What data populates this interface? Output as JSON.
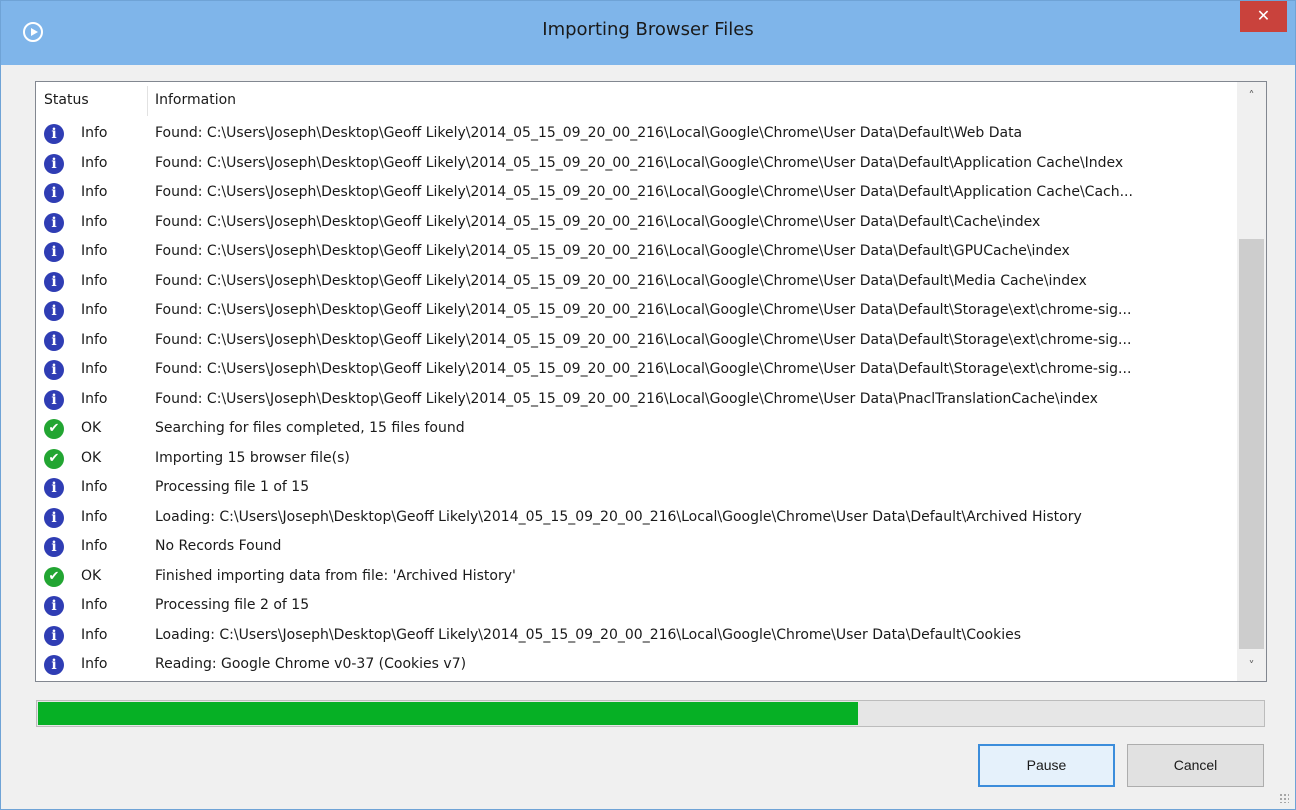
{
  "window": {
    "title": "Importing Browser Files",
    "close_glyph": "✕"
  },
  "columns": {
    "status": "Status",
    "information": "Information"
  },
  "rows": [
    {
      "icon": "info-icon",
      "status": "Info",
      "message": "Found: C:\\Users\\Joseph\\Desktop\\Geoff Likely\\2014_05_15_09_20_00_216\\Local\\Google\\Chrome\\User Data\\Default\\Web Data"
    },
    {
      "icon": "info-icon",
      "status": "Info",
      "message": "Found: C:\\Users\\Joseph\\Desktop\\Geoff Likely\\2014_05_15_09_20_00_216\\Local\\Google\\Chrome\\User Data\\Default\\Application Cache\\Index"
    },
    {
      "icon": "info-icon",
      "status": "Info",
      "message": "Found: C:\\Users\\Joseph\\Desktop\\Geoff Likely\\2014_05_15_09_20_00_216\\Local\\Google\\Chrome\\User Data\\Default\\Application Cache\\Cach..."
    },
    {
      "icon": "info-icon",
      "status": "Info",
      "message": "Found: C:\\Users\\Joseph\\Desktop\\Geoff Likely\\2014_05_15_09_20_00_216\\Local\\Google\\Chrome\\User Data\\Default\\Cache\\index"
    },
    {
      "icon": "info-icon",
      "status": "Info",
      "message": "Found: C:\\Users\\Joseph\\Desktop\\Geoff Likely\\2014_05_15_09_20_00_216\\Local\\Google\\Chrome\\User Data\\Default\\GPUCache\\index"
    },
    {
      "icon": "info-icon",
      "status": "Info",
      "message": "Found: C:\\Users\\Joseph\\Desktop\\Geoff Likely\\2014_05_15_09_20_00_216\\Local\\Google\\Chrome\\User Data\\Default\\Media Cache\\index"
    },
    {
      "icon": "info-icon",
      "status": "Info",
      "message": "Found: C:\\Users\\Joseph\\Desktop\\Geoff Likely\\2014_05_15_09_20_00_216\\Local\\Google\\Chrome\\User Data\\Default\\Storage\\ext\\chrome-sig..."
    },
    {
      "icon": "info-icon",
      "status": "Info",
      "message": "Found: C:\\Users\\Joseph\\Desktop\\Geoff Likely\\2014_05_15_09_20_00_216\\Local\\Google\\Chrome\\User Data\\Default\\Storage\\ext\\chrome-sig..."
    },
    {
      "icon": "info-icon",
      "status": "Info",
      "message": "Found: C:\\Users\\Joseph\\Desktop\\Geoff Likely\\2014_05_15_09_20_00_216\\Local\\Google\\Chrome\\User Data\\Default\\Storage\\ext\\chrome-sig..."
    },
    {
      "icon": "info-icon",
      "status": "Info",
      "message": "Found: C:\\Users\\Joseph\\Desktop\\Geoff Likely\\2014_05_15_09_20_00_216\\Local\\Google\\Chrome\\User Data\\PnaclTranslationCache\\index"
    },
    {
      "icon": "ok-icon",
      "status": "OK",
      "message": "Searching for files completed, 15 files found"
    },
    {
      "icon": "ok-icon",
      "status": "OK",
      "message": "Importing 15 browser file(s)"
    },
    {
      "icon": "info-icon",
      "status": "Info",
      "message": "Processing file 1 of 15"
    },
    {
      "icon": "info-icon",
      "status": "Info",
      "message": "Loading: C:\\Users\\Joseph\\Desktop\\Geoff Likely\\2014_05_15_09_20_00_216\\Local\\Google\\Chrome\\User Data\\Default\\Archived History"
    },
    {
      "icon": "info-icon",
      "status": "Info",
      "message": "No Records Found"
    },
    {
      "icon": "ok-icon",
      "status": "OK",
      "message": "Finished importing data from file: 'Archived History'"
    },
    {
      "icon": "info-icon",
      "status": "Info",
      "message": "Processing file 2 of 15"
    },
    {
      "icon": "info-icon",
      "status": "Info",
      "message": "Loading: C:\\Users\\Joseph\\Desktop\\Geoff Likely\\2014_05_15_09_20_00_216\\Local\\Google\\Chrome\\User Data\\Default\\Cookies"
    },
    {
      "icon": "info-icon",
      "status": "Info",
      "message": "Reading: Google Chrome v0-37 (Cookies v7)"
    }
  ],
  "progress": {
    "fraction": 0.669,
    "color": "#06b025"
  },
  "buttons": {
    "pause": "Pause",
    "cancel": "Cancel"
  },
  "colors": {
    "titlebar": "#7fb5ea",
    "close": "#c9423c",
    "info_icon": "#2f3db4",
    "ok_icon": "#22a532"
  }
}
